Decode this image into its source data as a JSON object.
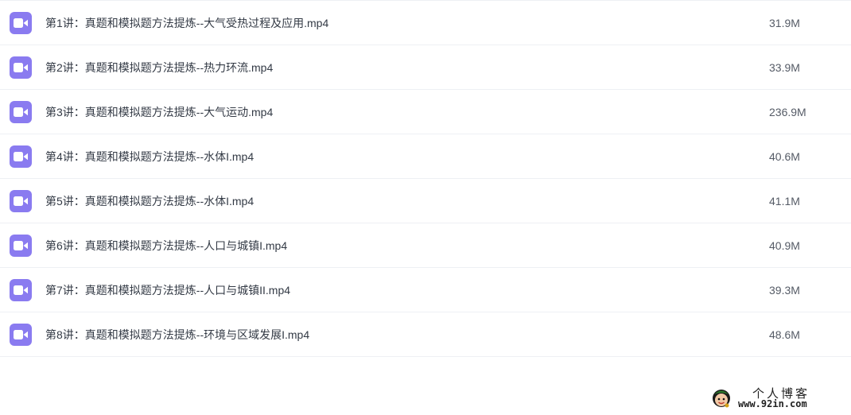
{
  "colors": {
    "icon_bg": "#8a7bf0",
    "divider": "#eef0f4",
    "text": "#333a45"
  },
  "files": [
    {
      "icon": "video-file-icon",
      "name": "第1讲：真题和模拟题方法提炼--大气受热过程及应用.mp4",
      "size": "31.9M"
    },
    {
      "icon": "video-file-icon",
      "name": "第2讲：真题和模拟题方法提炼--热力环流.mp4",
      "size": "33.9M"
    },
    {
      "icon": "video-file-icon",
      "name": "第3讲：真题和模拟题方法提炼--大气运动.mp4",
      "size": "236.9M"
    },
    {
      "icon": "video-file-icon",
      "name": "第4讲：真题和模拟题方法提炼--水体I.mp4",
      "size": "40.6M"
    },
    {
      "icon": "video-file-icon",
      "name": "第5讲：真题和模拟题方法提炼--水体I.mp4",
      "size": "41.1M"
    },
    {
      "icon": "video-file-icon",
      "name": "第6讲：真题和模拟题方法提炼--人口与城镇I.mp4",
      "size": "40.9M"
    },
    {
      "icon": "video-file-icon",
      "name": "第7讲：真题和模拟题方法提炼--人口与城镇II.mp4",
      "size": "39.3M"
    },
    {
      "icon": "video-file-icon",
      "name": "第8讲：真题和模拟题方法提炼--环境与区域发展I.mp4",
      "size": "48.6M"
    }
  ],
  "watermark": {
    "title": "个人博客",
    "url": "www.92in.com"
  }
}
